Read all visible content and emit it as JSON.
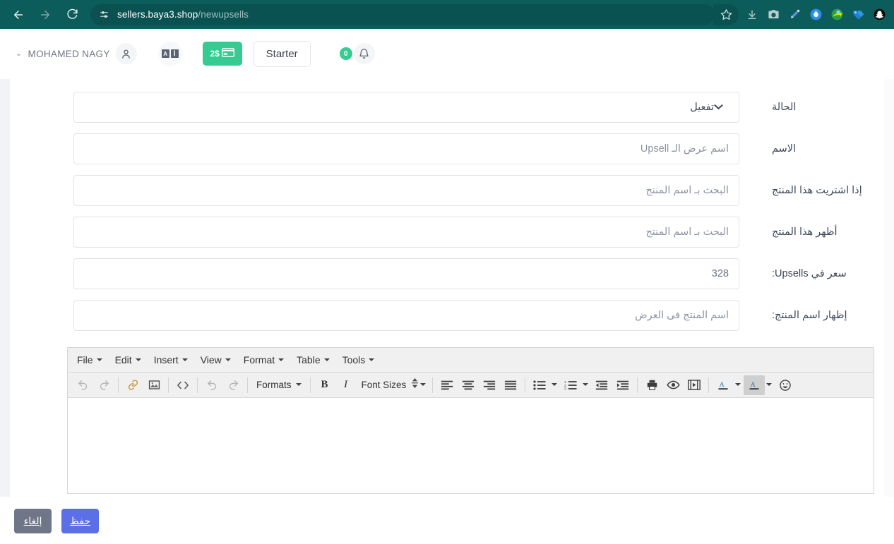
{
  "browser": {
    "back_icon": "back-arrow-icon",
    "forward_icon": "forward-arrow-icon",
    "reload_icon": "reload-icon",
    "site_info_icon": "site-settings-icon",
    "url_host": "sellers.baya3.shop",
    "url_path": "/newupsells",
    "bookmark_icon": "star-icon",
    "theme_color": "#0d5c5c",
    "extensions": [
      {
        "name": "downloads-icon",
        "glyph": "⬇"
      },
      {
        "name": "screenshot-camera-icon",
        "glyph": "▢"
      },
      {
        "name": "eyedropper-pen-icon",
        "glyph": "✒"
      },
      {
        "name": "water-drop-extension-icon",
        "glyph": "●"
      },
      {
        "name": "internet-download-manager-icon",
        "glyph": "●"
      },
      {
        "name": "tag-extension-icon",
        "glyph": "●"
      },
      {
        "name": "snapchat-extension-icon",
        "glyph": "●"
      }
    ]
  },
  "header": {
    "user_name": "MOHAMED NAGY",
    "user_chevron": "⌄",
    "avatar_icon": "user-avatar-icon",
    "translate_icon": "translate-icon",
    "translate_latin": "A",
    "translate_arabic": "أ",
    "credit_label": "2$",
    "credit_icon": "credit-card-icon",
    "plan_label": "Starter",
    "notification_count": "0",
    "bell_icon": "bell-icon",
    "accent_green": "#35cb92"
  },
  "form": {
    "rows": [
      {
        "label": "الحالة",
        "type": "select",
        "value": "تفعيل",
        "name": "status-select"
      },
      {
        "label": "الاسم",
        "type": "text",
        "value": "",
        "placeholder": "اسم عرض الـ Upsell",
        "name": "upsell-name-input"
      },
      {
        "label": "إذا اشتريت هذا المنتج",
        "type": "text",
        "value": "",
        "placeholder": "البحث بـ اسم المنتج",
        "name": "trigger-product-search-input"
      },
      {
        "label": "أظهر هذا المنتج",
        "type": "text",
        "value": "",
        "placeholder": "البحث بـ اسم المنتج",
        "name": "offer-product-search-input"
      },
      {
        "label": "سعر في Upsells:",
        "type": "text",
        "value": "328",
        "placeholder": "",
        "name": "upsell-price-input"
      },
      {
        "label": "إظهار اسم المنتج:",
        "type": "text",
        "value": "",
        "placeholder": "اسم المنتج فى العرض",
        "name": "display-product-name-input"
      }
    ]
  },
  "editor": {
    "menus": [
      {
        "label": "File",
        "name": "menu-file"
      },
      {
        "label": "Edit",
        "name": "menu-edit"
      },
      {
        "label": "Insert",
        "name": "menu-insert"
      },
      {
        "label": "View",
        "name": "menu-view"
      },
      {
        "label": "Format",
        "name": "menu-format"
      },
      {
        "label": "Table",
        "name": "menu-table"
      },
      {
        "label": "Tools",
        "name": "menu-tools"
      }
    ],
    "formats_label": "Formats",
    "font_sizes_label": "Font Sizes",
    "content": ""
  },
  "footer": {
    "cancel_label": "إلغاء",
    "save_label": "حفظ",
    "cancel_color": "#6e7687",
    "save_color": "#5b6fe6"
  }
}
